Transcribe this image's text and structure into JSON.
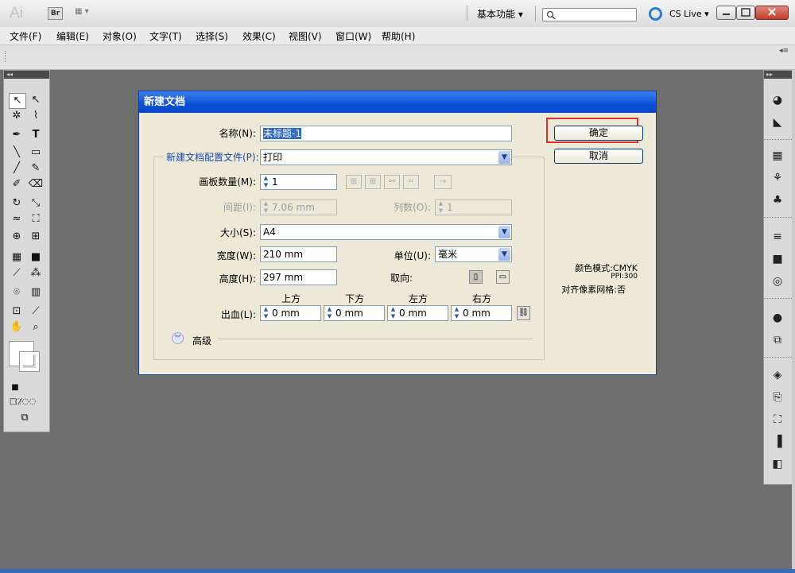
{
  "app": {
    "logo": "Ai",
    "bridge_label": "Br",
    "workspace_label": "基本功能",
    "cs_live_label": "CS Live"
  },
  "menu": [
    "文件(F)",
    "编辑(E)",
    "对象(O)",
    "文字(T)",
    "选择(S)",
    "效果(C)",
    "视图(V)",
    "窗口(W)",
    "帮助(H)"
  ],
  "dialog": {
    "title": "新建文档",
    "name_label": "名称(N):",
    "name_value": "未标题-1",
    "profile_label": "新建文档配置文件(P):",
    "profile_value": "打印",
    "artboards_label": "画板数量(M):",
    "artboards_value": "1",
    "spacing_label": "间距(I):",
    "spacing_value": "7.06 mm",
    "columns_label": "列数(O):",
    "columns_value": "1",
    "size_label": "大小(S):",
    "size_value": "A4",
    "width_label": "宽度(W):",
    "width_value": "210 mm",
    "units_label": "单位(U):",
    "units_value": "毫米",
    "height_label": "高度(H):",
    "height_value": "297 mm",
    "orientation_label": "取向:",
    "bleed_label": "出血(L):",
    "bleed_top_label": "上方",
    "bleed_bottom_label": "下方",
    "bleed_left_label": "左方",
    "bleed_right_label": "右方",
    "bleed_top": "0 mm",
    "bleed_bottom": "0 mm",
    "bleed_left": "0 mm",
    "bleed_right": "0 mm",
    "advanced_label": "高级",
    "ok_label": "确定",
    "cancel_label": "取消",
    "color_mode": "颜色模式:CMYK",
    "ppi": "PPI:300",
    "align_grid": "对齐像素网格:否"
  },
  "colors": {
    "dialog_title": "#0b50d6",
    "highlight": "#e0302a",
    "workspace_bg": "#6e6e6e"
  }
}
